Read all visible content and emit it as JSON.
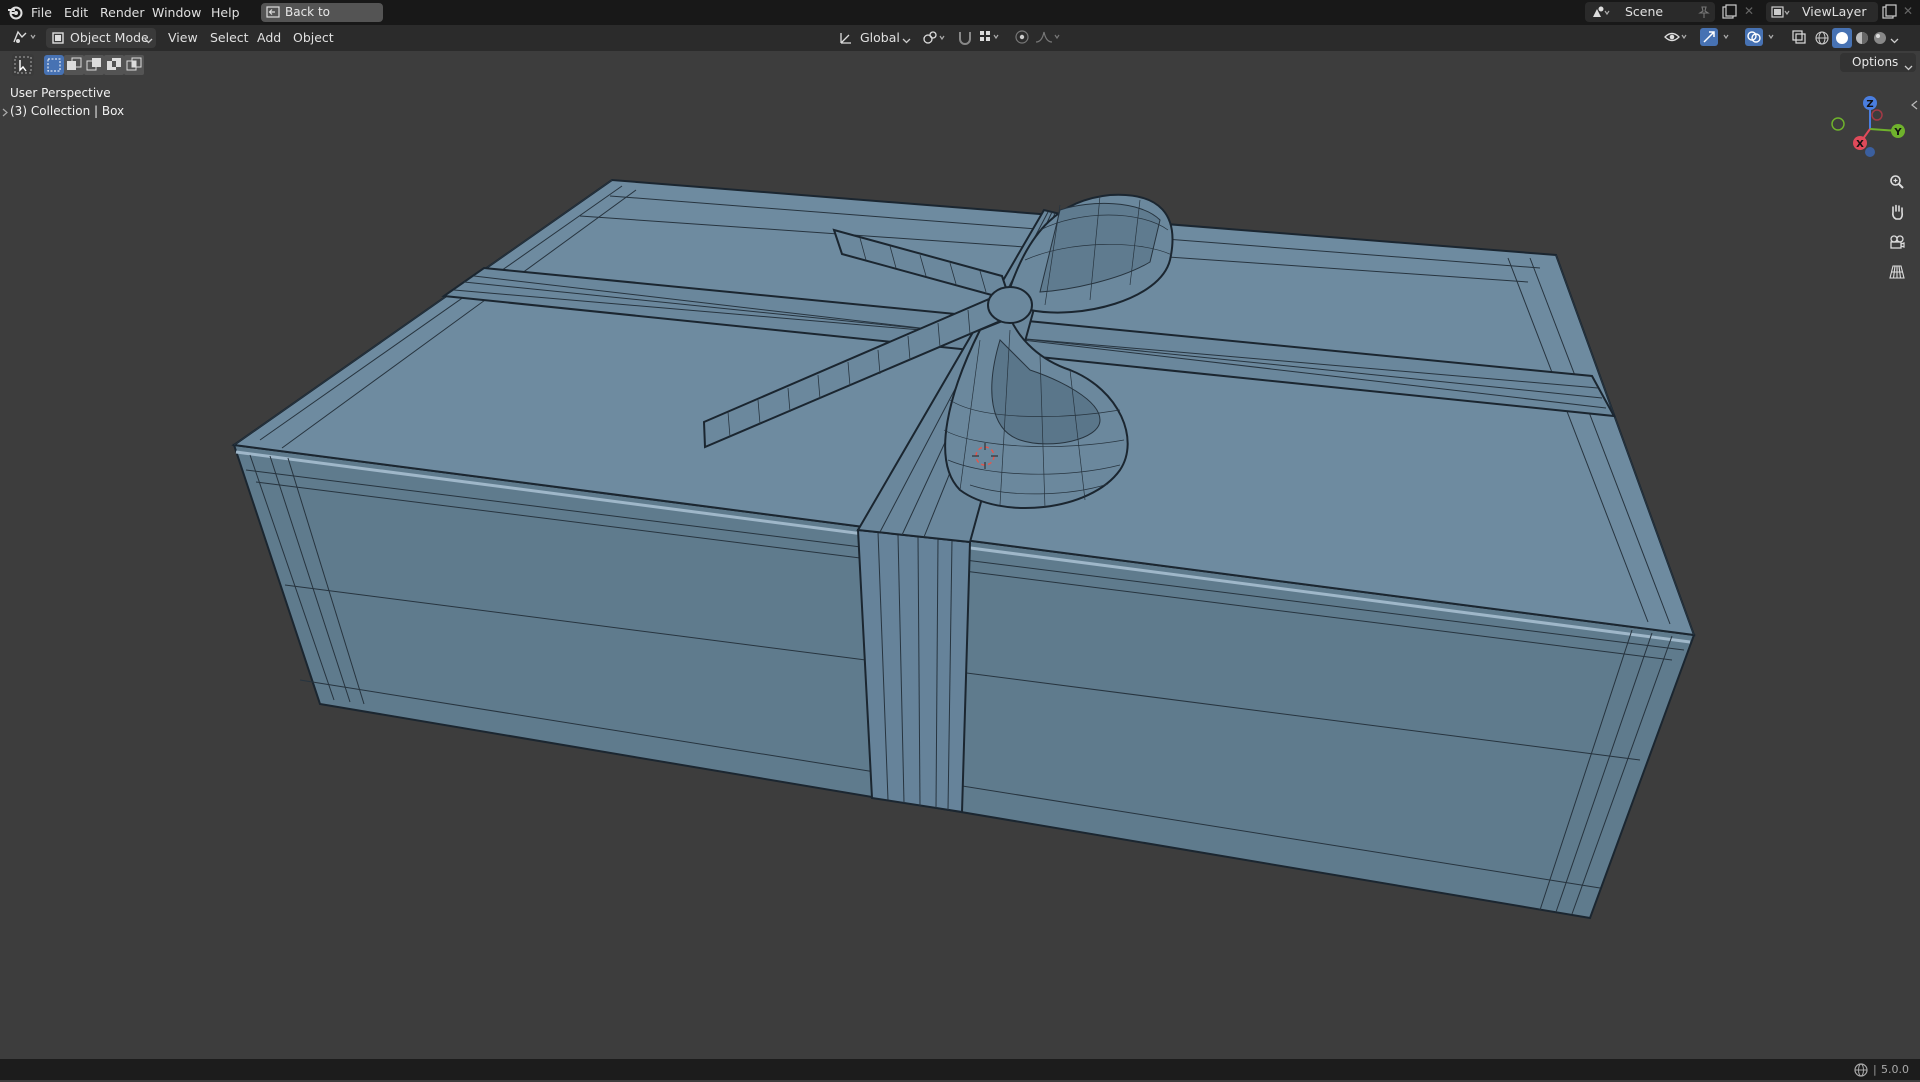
{
  "topbar": {
    "menus": [
      "File",
      "Edit",
      "Render",
      "Window",
      "Help"
    ],
    "back_button": "Back to Previous",
    "scene": "Scene",
    "view_layer": "ViewLayer"
  },
  "header": {
    "mode": "Object Mode",
    "menus": [
      "View",
      "Select",
      "Add",
      "Object"
    ],
    "transform_orientation": "Global",
    "options": "Options"
  },
  "overlay": {
    "view_name": "User Perspective",
    "collection": "(3) Collection | Box"
  },
  "gizmo": {
    "x": "X",
    "y": "Y",
    "z": "Z"
  },
  "status": {
    "version": "5.0.0"
  },
  "colors": {
    "mesh_fill": "#6e8ba0",
    "wire": "#1b2630",
    "background": "#3d3d3d"
  }
}
